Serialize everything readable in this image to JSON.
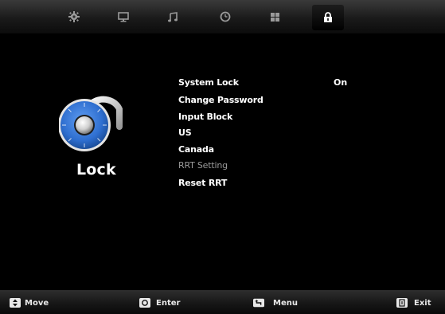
{
  "tabs": [
    {
      "icon": "gear-icon"
    },
    {
      "icon": "monitor-icon"
    },
    {
      "icon": "music-note-icon"
    },
    {
      "icon": "clock-icon"
    },
    {
      "icon": "grid-icon"
    },
    {
      "icon": "lock-icon",
      "active": true
    }
  ],
  "page": {
    "title": "Lock"
  },
  "menu": {
    "items": [
      {
        "label": "System Lock",
        "value": "On"
      },
      {
        "label": "Change Password"
      },
      {
        "label": "Input Block"
      },
      {
        "label": "US"
      },
      {
        "label": "Canada"
      },
      {
        "label": "RRT Setting",
        "disabled": true
      },
      {
        "label": "Reset RRT"
      }
    ]
  },
  "hints": [
    {
      "icon": "up-down-icon",
      "label": "Move"
    },
    {
      "icon": "enter-icon",
      "label": "Enter"
    },
    {
      "icon": "return-icon",
      "label": "Menu"
    },
    {
      "icon": "exit-icon",
      "label": "Exit"
    }
  ],
  "colors": {
    "background": "#000000",
    "dial_blue": "#2f6fd0",
    "disabled_text": "#9a9a9a"
  }
}
